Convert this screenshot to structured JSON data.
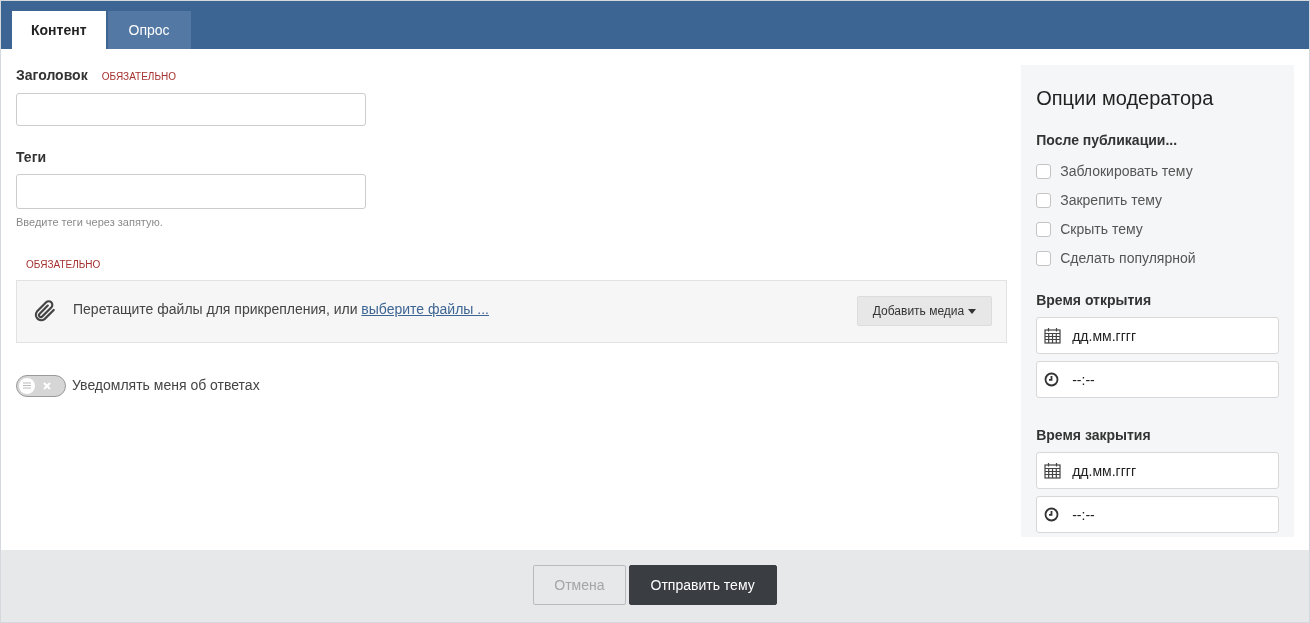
{
  "tabs": [
    {
      "label": "Контент",
      "selected": true
    },
    {
      "label": "Опрос",
      "selected": false
    }
  ],
  "title_field": {
    "label": "Заголовок",
    "required": "ОБЯЗАТЕЛЬНО"
  },
  "tags_field": {
    "label": "Теги",
    "hint": "Введите теги через запятую."
  },
  "attachments": {
    "required": "ОБЯЗАТЕЛЬНО",
    "text": "Перетащите файлы для прикрепления, или",
    "link": "выберите файлы ...",
    "button": "Добавить медиа"
  },
  "notify_toggle": {
    "label": "Уведомлять меня об ответах",
    "on": false
  },
  "moderator_options": {
    "title": "Опции модератора",
    "after_publish": "После публикации...",
    "checkboxes": [
      {
        "label": "Заблокировать тему",
        "checked": false
      },
      {
        "label": "Закрепить тему",
        "checked": false
      },
      {
        "label": "Скрыть тему",
        "checked": false
      },
      {
        "label": "Сделать популярной",
        "checked": false
      }
    ],
    "schedules": [
      {
        "label": "Время открытия",
        "date_placeholder": "дд.мм.гггг",
        "time_placeholder": "--:--"
      },
      {
        "label": "Время закрытия",
        "date_placeholder": "дд.мм.гггг",
        "time_placeholder": "--:--"
      }
    ]
  },
  "footer": {
    "buttons": [
      {
        "label": "Отмена",
        "kind": "secondary",
        "disabled": true
      },
      {
        "label": "Отправить тему",
        "kind": "primary",
        "disabled": false
      }
    ]
  }
}
